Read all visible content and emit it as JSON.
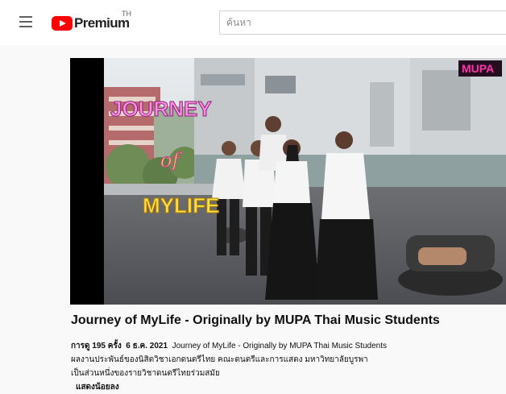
{
  "header": {
    "logo_text": "Premium",
    "region": "TH",
    "search_placeholder": "ค้นหา"
  },
  "video": {
    "thumbnail_overlay": {
      "channel_badge": "MUPA",
      "title_top": "JOURNEY",
      "title_mid": "of",
      "title_bottom": "MYLIFE"
    },
    "title": "Journey of MyLife - Originally by MUPA Thai Music Students",
    "views": "การดู 195 ครั้ง",
    "date": "6 ธ.ค. 2021",
    "description": [
      "Journey of MyLife - Originally by MUPA Thai Music Students",
      "ผลงานประพันธ์ของนิสิตวิชาเอกดนตรีไทย คณะดนตรีและการแสดง มหาวิทยาลัยบูรพา",
      "เป็นส่วนหนึ่งของรายวิชาดนตรีไทยร่วมสมัย"
    ],
    "show_less": "แสดงน้อยลง"
  },
  "colors": {
    "brand_red": "#ff0000",
    "badge_pink": "#ff33aa",
    "title_gold": "#ffe14a",
    "title_pink": "#ff8fe0"
  }
}
